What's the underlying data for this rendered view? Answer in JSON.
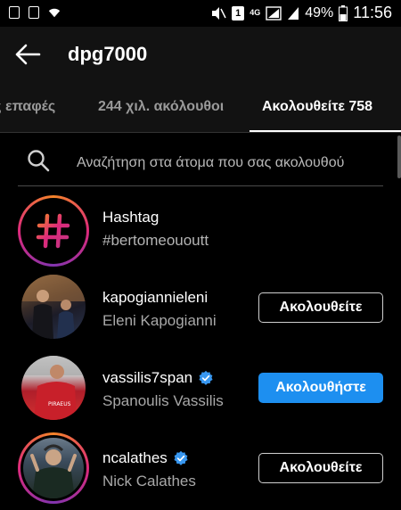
{
  "status_bar": {
    "battery": "49%",
    "time": "11:56",
    "network": "4G"
  },
  "header": {
    "title": "dpg7000"
  },
  "tabs": [
    {
      "label": "ές επαφές"
    },
    {
      "label": "244 χιλ. ακόλουθοι"
    },
    {
      "label": "Ακολουθείτε 758",
      "active": true
    }
  ],
  "search": {
    "placeholder": "Αναζήτηση στα άτομα που σας ακολουθού"
  },
  "rows": [
    {
      "name": "Hashtag",
      "sub": "#bertomeououtt",
      "type": "hashtag"
    },
    {
      "name": "kapogiannieleni",
      "sub": "Eleni Kapogianni",
      "button": "Ακολουθείτε"
    },
    {
      "name": "vassilis7span",
      "sub": "Spanoulis Vassilis",
      "verified": true,
      "button": "Ακολουθήστε"
    },
    {
      "name": "ncalathes",
      "sub": "Nick Calathes",
      "verified": true,
      "button": "Ακολουθείτε"
    }
  ],
  "colors": {
    "accent_blue": "#1d8ff0",
    "background": "#000000",
    "header_bg": "#121212"
  }
}
